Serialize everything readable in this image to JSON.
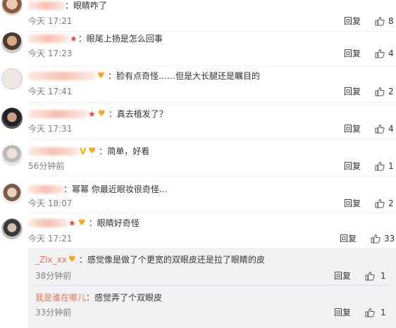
{
  "comments": [
    {
      "text": "：眼睛咋了",
      "time": "今天 17:21",
      "reply": "回复",
      "likes": "8"
    },
    {
      "text": "：眼尾上扬是怎么回事",
      "time": "今天 17:23",
      "reply": "回复",
      "likes": "4"
    },
    {
      "text": "：脸有点奇怪……但是大长腿还是瞩目的",
      "time": "今天 17:41",
      "reply": "回复",
      "likes": "2"
    },
    {
      "text": "：真去植发了？",
      "time": "今天 17:31",
      "reply": "回复",
      "likes": "4"
    },
    {
      "text": "：简单，好看",
      "time": "56分钟前",
      "reply": "回复",
      "likes": "1"
    },
    {
      "text": "：幂幂 你最近眼妆很奇怪...",
      "time": "今天 18:07",
      "reply": "回复",
      "likes": "2"
    },
    {
      "text": "：眼睛好奇怪",
      "time": "今天 17:21",
      "reply": "回复",
      "likes": "33"
    }
  ],
  "replies": [
    {
      "user": "_Zlx_xx",
      "text": "：感觉像是做了个更宽的双眼皮还是拉了眼睛的皮",
      "time": "38分钟前",
      "reply": "回复",
      "likes": "1"
    },
    {
      "user": "我是谁在哪儿",
      "text": "：感觉弄了个双眼皮",
      "time": "33分钟前",
      "reply": "回复",
      "likes": "1"
    }
  ],
  "colors": {
    "username": "#eb7350",
    "time": "#808080",
    "badge_star": "#e8423a",
    "badge_v": "#f7b500",
    "badge_heart": "#f5a623"
  },
  "icons": {
    "like": "thumbs-up-icon",
    "badge_heart": "member-heart-icon",
    "badge_star": "star-badge-icon",
    "badge_v": "verified-v-icon"
  }
}
